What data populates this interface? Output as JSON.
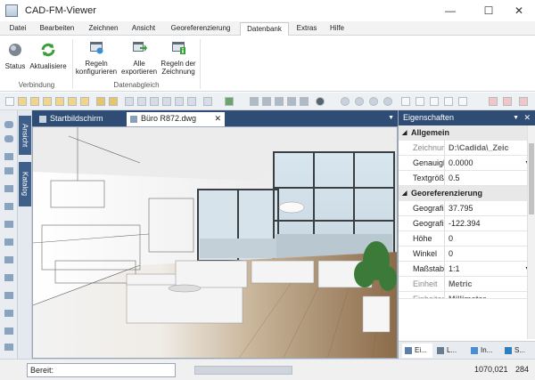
{
  "window": {
    "title": "CAD-FM-Viewer",
    "minimize": "—",
    "maximize": "☐",
    "close": "✕"
  },
  "menu": {
    "tabs": [
      "Datei",
      "Bearbeiten",
      "Zeichnen",
      "Ansicht",
      "Georeferenzierung",
      "Datenbank",
      "Extras",
      "Hilfe"
    ],
    "active": "Datenbank"
  },
  "ribbon": {
    "buttons": {
      "status": "Status",
      "aktualisiere": "Aktualisiere",
      "regeln1": "Regeln",
      "regeln2": "konfigurieren",
      "alle1": "Alle",
      "alle2": "exportieren",
      "regeln_z1": "Regeln der",
      "regeln_z2": "Zeichnung"
    },
    "groups": {
      "verbindung": "Verbindung",
      "datenabgleich": "Datenabgleich"
    }
  },
  "sidebar": {
    "tabs": {
      "ansicht": "Ansicht",
      "katalog": "Katalog"
    }
  },
  "document_tabs": {
    "items": [
      "Startbildschirm",
      "Büro R872.dwg"
    ],
    "active": "Büro R872.dwg"
  },
  "properties": {
    "title": "Eigenschaften",
    "sections": {
      "allgemein": "Allgemein",
      "georef": "Georeferenzierung"
    },
    "rows": {
      "zeichnungsr": {
        "key": "Zeichnungsr",
        "value": "D:\\Cadida\\_Zeic"
      },
      "genauigkeit": {
        "key": "Genauigkeit",
        "value": "0.0000"
      },
      "textgroesse": {
        "key": "Textgröße",
        "value": "0.5"
      },
      "geo1": {
        "key": "Geografische",
        "value": "37.795"
      },
      "geo2": {
        "key": "Geografische",
        "value": "-122.394"
      },
      "hoehe": {
        "key": "Höhe",
        "value": "0"
      },
      "winkel": {
        "key": "Winkel",
        "value": "0"
      },
      "massstab": {
        "key": "Maßstab",
        "value": "1:1"
      },
      "einheit": {
        "key": "Einheit",
        "value": "Metric"
      },
      "einheit_trunc": {
        "key": "Einheiten",
        "value": "Millimeter"
      }
    },
    "bottom_tabs": [
      "Ei...",
      "L...",
      "In...",
      "S..."
    ]
  },
  "status": {
    "ready": "Bereit:",
    "coords": "1070,021",
    "extra": "284"
  },
  "colors": {
    "accent": "#2f4d74",
    "tab_active": "#ffffff"
  }
}
